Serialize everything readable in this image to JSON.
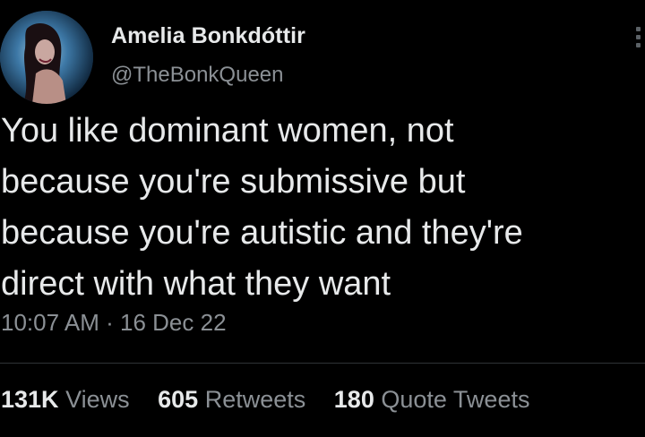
{
  "author": {
    "name": "Amelia Bonkdóttir",
    "handle": "@TheBonkQueen",
    "avatar": "profile-photo"
  },
  "tweet": {
    "text": "You like dominant women, not\nbecause you're submissive but\nbecause you're autistic and they're\ndirect with what they want",
    "time": "10:07 AM",
    "separator": "·",
    "date": "16 Dec 22"
  },
  "stats": [
    {
      "value": "131K",
      "label": "Views"
    },
    {
      "value": "605",
      "label": "Retweets"
    },
    {
      "value": "180",
      "label": "Quote Tweets"
    }
  ],
  "colors": {
    "background": "#000000",
    "primary_text": "#e7e9ea",
    "secondary_text": "#8b9095",
    "divider": "#2f3336"
  }
}
